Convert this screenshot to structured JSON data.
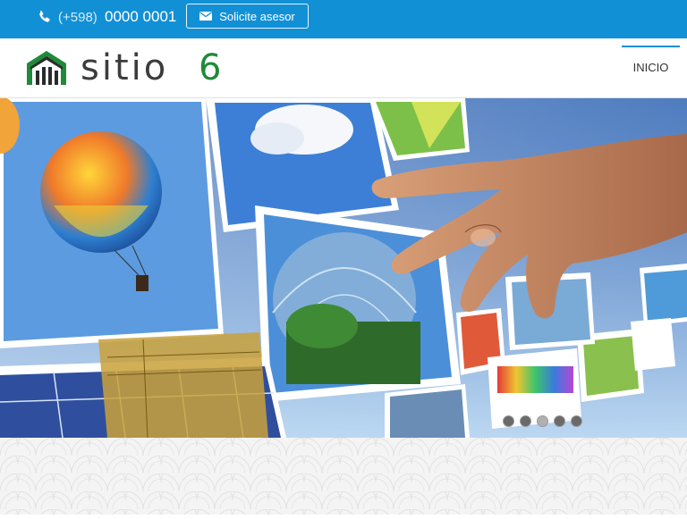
{
  "topbar": {
    "phone_icon": "phone-icon",
    "phone_prefix": "(+598)",
    "phone_number": "0000 0001",
    "advisor_icon": "envelope-icon",
    "advisor_label": "Solicite asesor"
  },
  "header": {
    "logo_text": "sitio",
    "logo_number": "6",
    "nav": {
      "inicio": "INICIO"
    }
  },
  "slider": {
    "slide_count": 5,
    "active_slide": 3
  },
  "colors": {
    "brand_blue": "#1290d6",
    "logo_green": "#1f8a3a",
    "text_dark": "#3c3c3c"
  }
}
